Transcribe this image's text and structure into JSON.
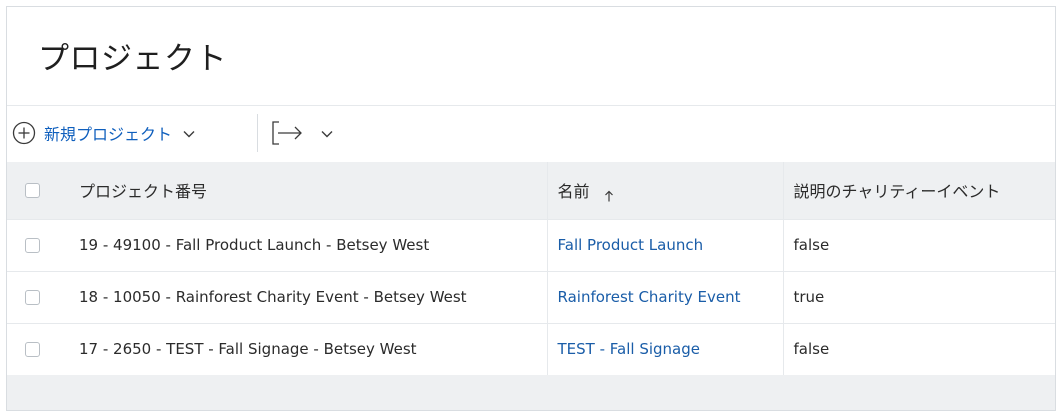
{
  "header": {
    "title": "プロジェクト"
  },
  "toolbar": {
    "new_project_label": "新規プロジェクト",
    "icons": [
      "plus-circle-icon",
      "chevron-down-icon",
      "export-arrow-icon",
      "chevron-down-icon"
    ]
  },
  "table": {
    "columns": [
      {
        "label": "プロジェクト番号"
      },
      {
        "label": "名前",
        "sort": "↑"
      },
      {
        "label": "説明のチャリティーイベント"
      }
    ],
    "rows": [
      {
        "number": "19 - 49100 - Fall Product Launch - Betsey West",
        "name": "Fall Product Launch",
        "desc": "false"
      },
      {
        "number": "18 - 10050 - Rainforest Charity Event - Betsey West",
        "name": "Rainforest Charity Event",
        "desc": "true"
      },
      {
        "number": "17 - 2650 - TEST - Fall Signage - Betsey West",
        "name": "TEST - Fall Signage",
        "desc": "false"
      }
    ]
  },
  "colors": {
    "link": "#1a5da8",
    "accent": "#0f5fbd",
    "header_bg": "#eef0f2",
    "border": "#d9dde1"
  }
}
